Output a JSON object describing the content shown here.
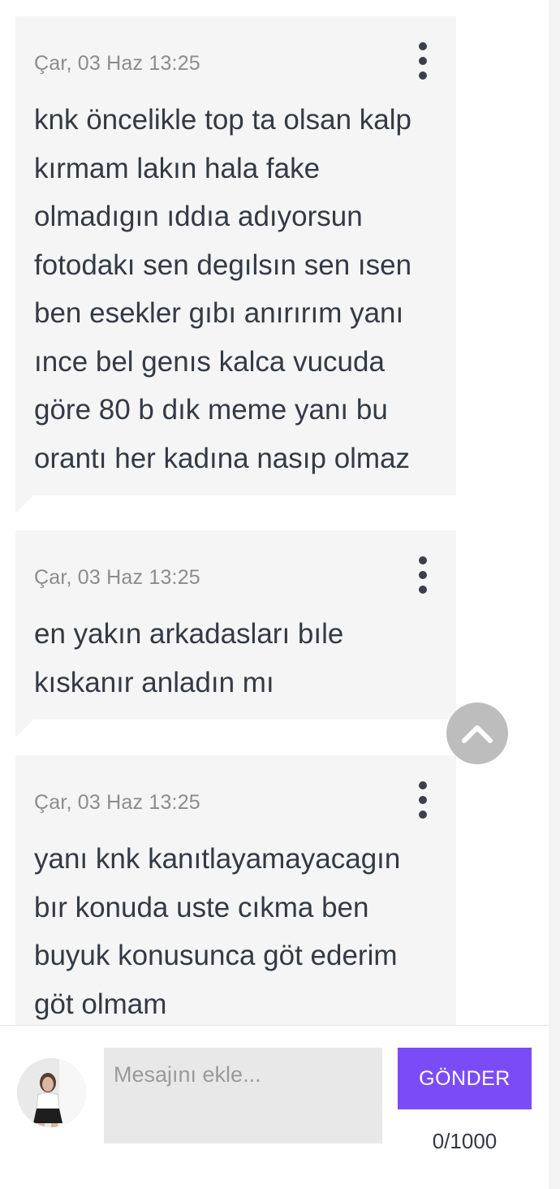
{
  "messages": [
    {
      "timestamp": "Çar, 03 Haz 13:25",
      "text": "knk öncelikle top ta olsan kalp\nkırmam lakın hala fake\nolmadıgın ıddıa adıyorsun\nfotodakı sen degılsın sen ısen\nben esekler gıbı anırırım yanı\nınce bel genıs kalca vucuda\ngöre 80 b dık meme yanı bu\norantı her kadına nasıp olmaz"
    },
    {
      "timestamp": "Çar, 03 Haz 13:25",
      "text": "en yakın arkadasları bıle\nkıskanır anladın mı"
    },
    {
      "timestamp": "Çar, 03 Haz 13:25",
      "text": "yanı knk kanıtlayamayacagın\nbır konuda uste cıkma ben\nbuyuk konusunca göt ederim\ngöt olmam"
    }
  ],
  "icons": {
    "more_menu": "vertical-dots-icon",
    "scroll_top": "chevron-up-icon",
    "avatar": "user-avatar"
  },
  "composer": {
    "placeholder": "Mesajını ekle...",
    "value": "",
    "send_label": "GÖNDER",
    "counter": "0/1000"
  },
  "colors": {
    "bubble_bg": "#f5f5f5",
    "send_button": "#7b4cf6",
    "timestamp": "#8c8c8c",
    "text": "#333a45",
    "scroll_top_button": "#bdbdbd"
  }
}
